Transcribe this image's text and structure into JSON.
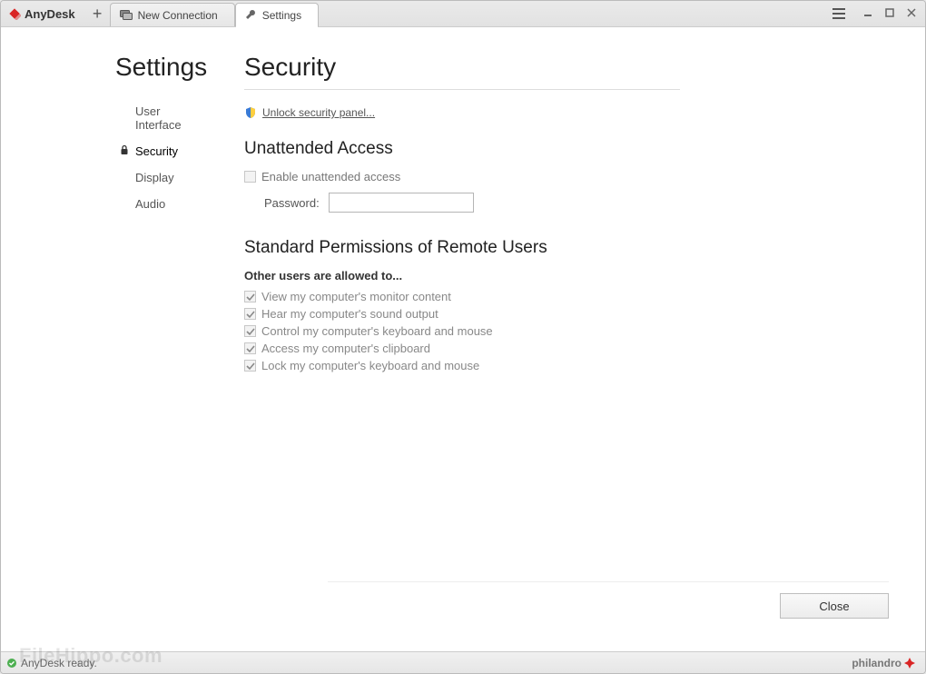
{
  "app": {
    "name": "AnyDesk"
  },
  "tabs": [
    {
      "label": "New Connection",
      "active": false
    },
    {
      "label": "Settings",
      "active": true
    }
  ],
  "sidebar": {
    "title": "Settings",
    "items": [
      {
        "label": "User Interface",
        "selected": false,
        "locked": false
      },
      {
        "label": "Security",
        "selected": true,
        "locked": true
      },
      {
        "label": "Display",
        "selected": false,
        "locked": false
      },
      {
        "label": "Audio",
        "selected": false,
        "locked": false
      }
    ]
  },
  "main": {
    "title": "Security",
    "unlock_label": "Unlock security panel...",
    "unattended": {
      "heading": "Unattended Access",
      "enable_label": "Enable unattended access",
      "enable_checked": false,
      "password_label": "Password:",
      "password_value": ""
    },
    "permissions": {
      "heading": "Standard Permissions of Remote Users",
      "subheading": "Other users are allowed to...",
      "items": [
        {
          "label": "View my computer's monitor content",
          "checked": true
        },
        {
          "label": "Hear my computer's sound output",
          "checked": true
        },
        {
          "label": "Control my computer's keyboard and mouse",
          "checked": true
        },
        {
          "label": "Access my computer's clipboard",
          "checked": true
        },
        {
          "label": "Lock my computer's keyboard and mouse",
          "checked": true
        }
      ]
    },
    "close_label": "Close"
  },
  "status": {
    "text": "AnyDesk ready.",
    "brand_footer": "philandro"
  },
  "watermark": "FileHippo.com"
}
